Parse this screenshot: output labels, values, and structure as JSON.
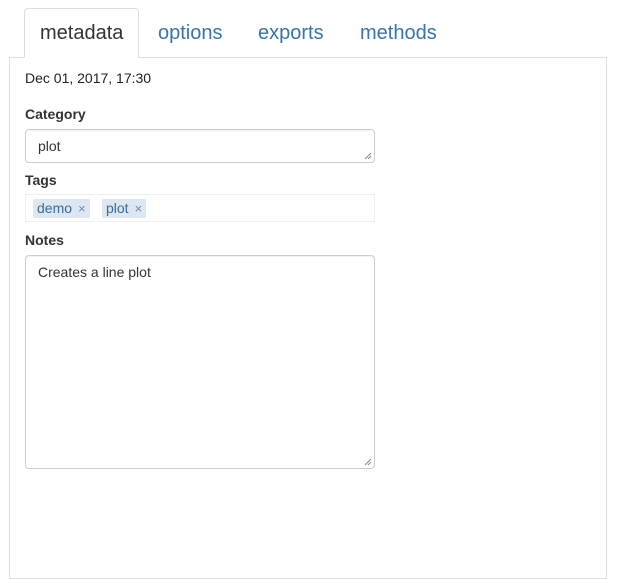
{
  "tabs": [
    {
      "label": "metadata",
      "active": true
    },
    {
      "label": "options",
      "active": false
    },
    {
      "label": "exports",
      "active": false
    },
    {
      "label": "methods",
      "active": false
    }
  ],
  "metadata": {
    "timestamp": "Dec 01, 2017, 17:30",
    "category_label": "Category",
    "category_value": "plot",
    "tags_label": "Tags",
    "tags": [
      "demo",
      "plot"
    ],
    "notes_label": "Notes",
    "notes_value": "Creates a line plot"
  },
  "colors": {
    "link": "#3a73a8",
    "tag_bg": "#dce7f2",
    "tag_text": "#3a6a96",
    "border": "#dddddd"
  },
  "icons": {
    "tag_remove": "close-icon",
    "resize": "resize-grip-icon"
  }
}
